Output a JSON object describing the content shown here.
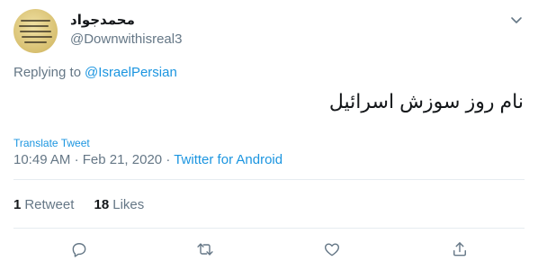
{
  "author": {
    "name": "محمدجواد",
    "handle": "@Downwithisreal3"
  },
  "reply": {
    "prefix": "Replying to",
    "mention": "@IsraelPersian"
  },
  "tweet": {
    "text": "نام روز سوزش اسرائیل",
    "translate_label": "Translate Tweet",
    "time": "10:49 AM",
    "date": "Feb 21, 2020",
    "separator": "·",
    "source": "Twitter for Android"
  },
  "stats": {
    "retweets_count": "1",
    "retweets_label": "Retweet",
    "likes_count": "18",
    "likes_label": "Likes"
  },
  "icons": {
    "menu": "chevron-down-icon",
    "reply": "reply-icon",
    "retweet": "retweet-icon",
    "like": "heart-icon",
    "share": "share-icon"
  },
  "colors": {
    "link": "#1b95e0",
    "secondary_text": "#657786",
    "primary_text": "#14171a",
    "divider": "#e6ecf0"
  }
}
